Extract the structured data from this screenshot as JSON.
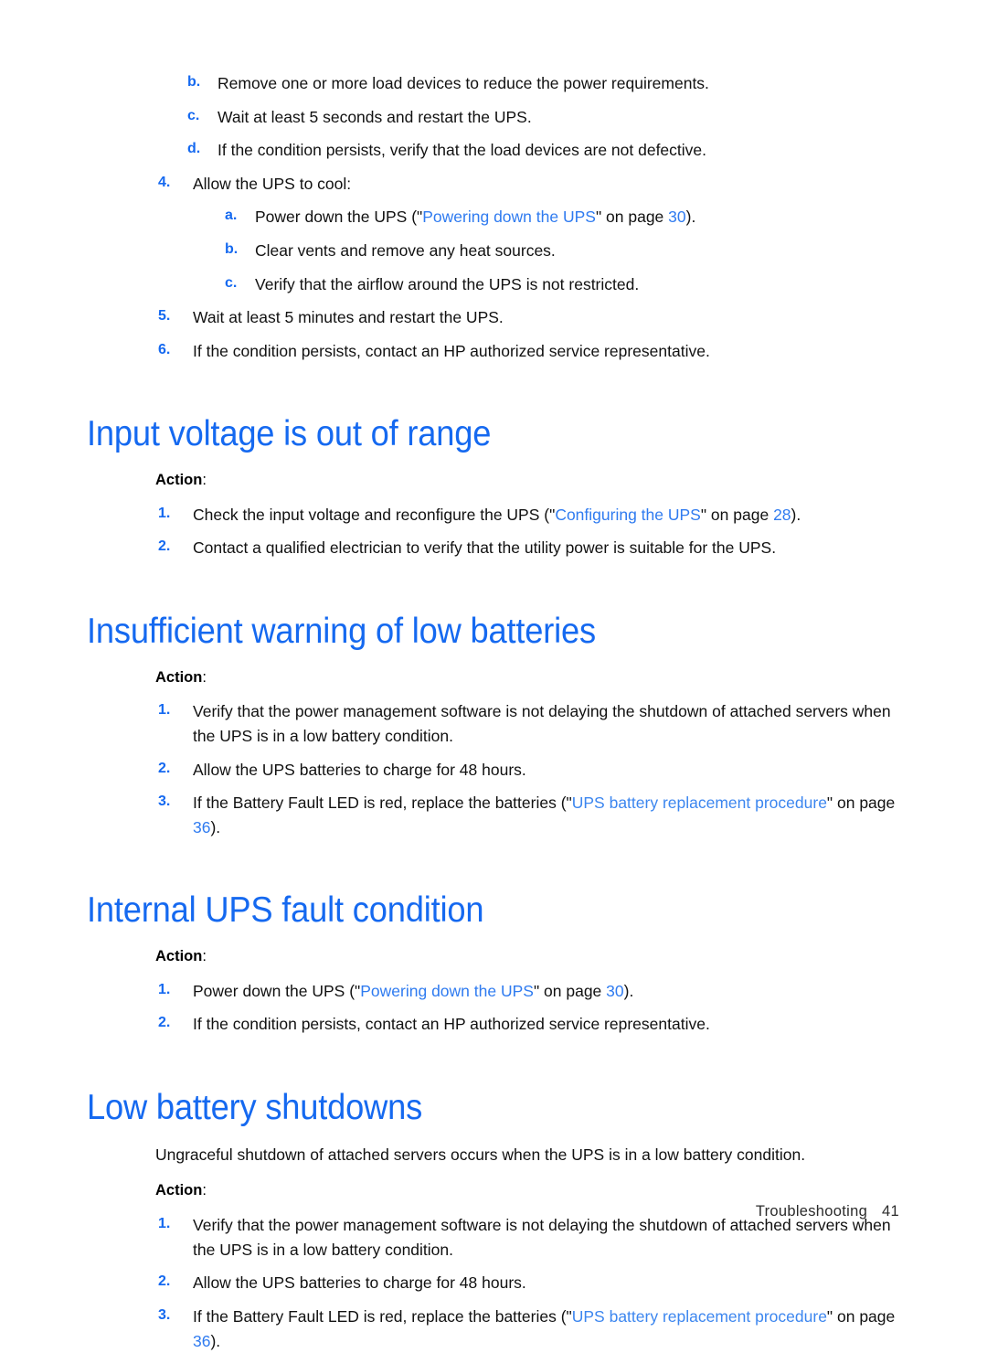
{
  "page": {
    "footer_section": "Troubleshooting",
    "footer_page_number": "41",
    "heading_color": "#1569f0",
    "link_color": "#2f7bf0",
    "marker_color": "#1569f0",
    "body_color": "#111111"
  },
  "continued_list": {
    "sub_items_top": [
      {
        "marker": "b.",
        "text": "Remove one or more load devices to reduce the power requirements."
      },
      {
        "marker": "c.",
        "text": "Wait at least 5 seconds and restart the UPS."
      },
      {
        "marker": "d.",
        "text": "If the condition persists, verify that the load devices are not defective."
      }
    ],
    "item4": {
      "marker": "4.",
      "text": "Allow the UPS to cool:",
      "sub_items": [
        {
          "marker": "a.",
          "pre": "Power down the UPS (\"",
          "link": "Powering down the UPS",
          "mid": "\" on page ",
          "page": "30",
          "post": ")."
        },
        {
          "marker": "b.",
          "text": "Clear vents and remove any heat sources."
        },
        {
          "marker": "c.",
          "text": "Verify that the airflow around the UPS is not restricted."
        }
      ]
    },
    "item5": {
      "marker": "5.",
      "text": "Wait at least 5 minutes and restart the UPS."
    },
    "item6": {
      "marker": "6.",
      "text": "If the condition persists, contact an HP authorized service representative."
    }
  },
  "sections": [
    {
      "heading": "Input voltage is out of range",
      "action_label": "Action",
      "action_colon": ":",
      "items": [
        {
          "marker": "1.",
          "pre": "Check the input voltage and reconfigure the UPS (\"",
          "link": "Configuring the UPS",
          "mid": "\" on page ",
          "page": "28",
          "post": ")."
        },
        {
          "marker": "2.",
          "text": "Contact a qualified electrician to verify that the utility power is suitable for the UPS."
        }
      ]
    },
    {
      "heading": "Insufficient warning of low batteries",
      "action_label": "Action",
      "action_colon": ":",
      "items": [
        {
          "marker": "1.",
          "text": "Verify that the power management software is not delaying the shutdown of attached servers when the UPS is in a low battery condition."
        },
        {
          "marker": "2.",
          "text": "Allow the UPS batteries to charge for 48 hours."
        },
        {
          "marker": "3.",
          "pre": "If the Battery Fault LED is red, replace the batteries (\"",
          "link": "UPS battery replacement procedure",
          "mid": "\" on page ",
          "page": "36",
          "post": ")."
        }
      ]
    },
    {
      "heading": "Internal UPS fault condition",
      "action_label": "Action",
      "action_colon": ":",
      "items": [
        {
          "marker": "1.",
          "pre": "Power down the UPS (\"",
          "link": "Powering down the UPS",
          "mid": "\" on page ",
          "page": "30",
          "post": ")."
        },
        {
          "marker": "2.",
          "text": "If the condition persists, contact an HP authorized service representative."
        }
      ]
    },
    {
      "heading": "Low battery shutdowns",
      "intro": "Ungraceful shutdown of attached servers occurs when the UPS is in a low battery condition.",
      "action_label": "Action",
      "action_colon": ":",
      "items": [
        {
          "marker": "1.",
          "text": "Verify that the power management software is not delaying the shutdown of attached servers when the UPS is in a low battery condition."
        },
        {
          "marker": "2.",
          "text": "Allow the UPS batteries to charge for 48 hours."
        },
        {
          "marker": "3.",
          "pre": "If the Battery Fault LED is red, replace the batteries (\"",
          "link": "UPS battery replacement procedure",
          "mid": "\" on page ",
          "page": "36",
          "post": ")."
        }
      ]
    }
  ]
}
